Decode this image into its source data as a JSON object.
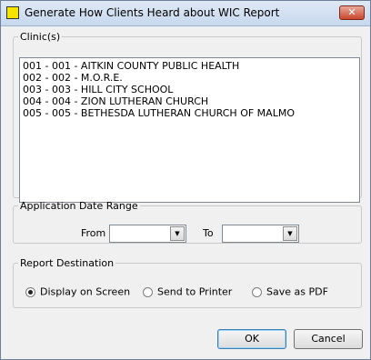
{
  "window": {
    "title": "Generate How Clients Heard about WIC Report",
    "close_label": "✕"
  },
  "clinics": {
    "legend": "Clinic(s)",
    "items": [
      "001 - 001 - AITKIN COUNTY PUBLIC HEALTH",
      "002 - 002 - M.O.R.E.",
      "003 - 003 - HILL CITY SCHOOL",
      "004 - 004 - ZION LUTHERAN CHURCH",
      "005 - 005 - BETHESDA LUTHERAN CHURCH OF MALMO"
    ]
  },
  "date_range": {
    "legend": "Application Date Range",
    "from_label": "From",
    "from_value": "",
    "to_label": "To",
    "to_value": ""
  },
  "destination": {
    "legend": "Report Destination",
    "options": [
      {
        "label": "Display on Screen",
        "checked": true
      },
      {
        "label": "Send to Printer",
        "checked": false
      },
      {
        "label": "Save as PDF",
        "checked": false
      }
    ]
  },
  "buttons": {
    "ok": "OK",
    "cancel": "Cancel"
  },
  "icons": {
    "dropdown": "▼"
  }
}
